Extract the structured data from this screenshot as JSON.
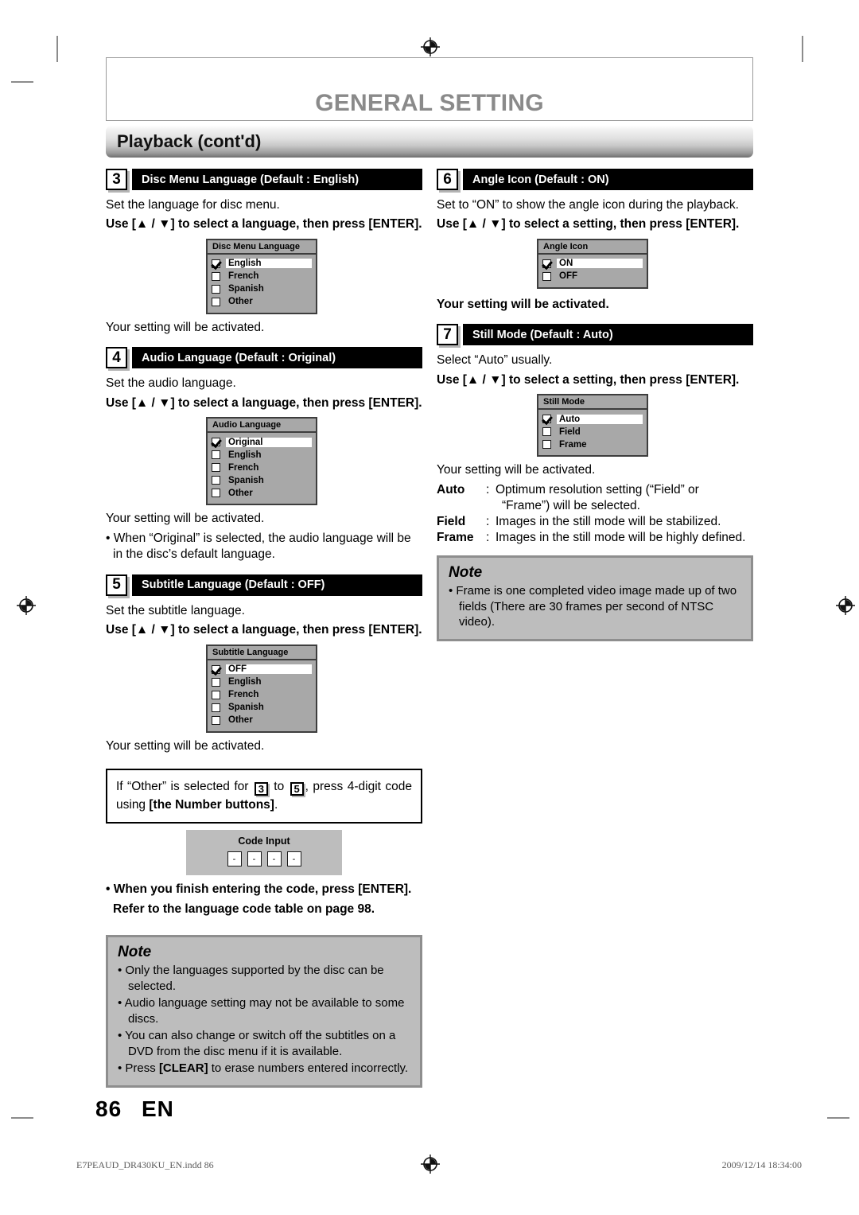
{
  "header": {
    "title": "GENERAL SETTING",
    "section_bar": "Playback (cont'd)"
  },
  "left_column": {
    "step3": {
      "number": "3",
      "title": "Disc Menu Language (Default : English)",
      "desc": "Set the language for disc menu.",
      "instruction": "Use [▲ / ▼] to select a language, then press [ENTER].",
      "osd": {
        "title": "Disc Menu Language",
        "options": [
          {
            "label": "English",
            "selected": true
          },
          {
            "label": "French",
            "selected": false
          },
          {
            "label": "Spanish",
            "selected": false
          },
          {
            "label": "Other",
            "selected": false
          }
        ]
      },
      "after": "Your setting will be activated."
    },
    "step4": {
      "number": "4",
      "title": "Audio Language (Default : Original)",
      "desc": "Set the audio language.",
      "instruction": "Use [▲ / ▼] to select a language, then press [ENTER].",
      "osd": {
        "title": "Audio Language",
        "options": [
          {
            "label": "Original",
            "selected": true
          },
          {
            "label": "English",
            "selected": false
          },
          {
            "label": "French",
            "selected": false
          },
          {
            "label": "Spanish",
            "selected": false
          },
          {
            "label": "Other",
            "selected": false
          }
        ]
      },
      "after": "Your setting will be activated.",
      "bullet": "• When “Original” is selected, the audio language will be in the disc’s default language."
    },
    "step5": {
      "number": "5",
      "title": "Subtitle Language (Default : OFF)",
      "desc": "Set the subtitle language.",
      "instruction": "Use [▲ / ▼] to select a language, then press [ENTER].",
      "osd": {
        "title": "Subtitle Language",
        "options": [
          {
            "label": "OFF",
            "selected": true
          },
          {
            "label": "English",
            "selected": false
          },
          {
            "label": "French",
            "selected": false
          },
          {
            "label": "Spanish",
            "selected": false
          },
          {
            "label": "Other",
            "selected": false
          }
        ]
      },
      "after": "Your setting will be activated."
    },
    "callout": {
      "part1": "If “Other” is selected for",
      "num_from": "3",
      "part2": "to",
      "num_to": "5",
      "part3": ", press 4-digit code using",
      "bold_part": "[the Number buttons]",
      "part4": "."
    },
    "code_osd": {
      "title": "Code Input",
      "cells": [
        "-",
        "-",
        "-",
        "-"
      ]
    },
    "code_note_line1": "• When you finish entering the code, press [ENTER].",
    "code_note_line2": "Refer to the language code table on page 98.",
    "note": {
      "title": "Note",
      "items": [
        "• Only the languages supported by the disc can be selected.",
        "• Audio language setting may not be available to some discs.",
        "• You can also change or switch off the subtitles on a DVD from the disc menu if it is available.",
        "• Press [CLEAR] to erase numbers entered incorrectly."
      ]
    }
  },
  "right_column": {
    "step6": {
      "number": "6",
      "title": "Angle Icon (Default : ON)",
      "desc": "Set to “ON” to show the angle icon during the playback.",
      "instruction": "Use [▲ / ▼] to select a setting, then press [ENTER].",
      "osd": {
        "title": "Angle Icon",
        "options": [
          {
            "label": "ON",
            "selected": true
          },
          {
            "label": "OFF",
            "selected": false
          }
        ]
      },
      "after": "Your setting will be activated."
    },
    "step7": {
      "number": "7",
      "title": "Still Mode (Default : Auto)",
      "desc": "Select “Auto” usually.",
      "instruction": "Use [▲ / ▼] to select a setting, then press [ENTER].",
      "osd": {
        "title": "Still Mode",
        "options": [
          {
            "label": "Auto",
            "selected": true
          },
          {
            "label": "Field",
            "selected": false
          },
          {
            "label": "Frame",
            "selected": false
          }
        ]
      },
      "after": "Your setting will be activated.",
      "definitions": [
        {
          "term": "Auto",
          "colon": ":",
          "desc": "Optimum resolution setting (“Field” or",
          "cont": "“Frame”) will be selected."
        },
        {
          "term": "Field",
          "colon": ":",
          "desc": "Images in the still mode will be stabilized.",
          "cont": ""
        },
        {
          "term": "Frame",
          "colon": ":",
          "desc": "Images in the still mode will be highly defined.",
          "cont": ""
        }
      ]
    },
    "note": {
      "title": "Note",
      "items": [
        "• Frame is one completed video image made up of two fields (There are 30 frames per second of NTSC video)."
      ]
    }
  },
  "footer": {
    "page_number": "86",
    "page_lang": "EN",
    "file_name": "E7PEAUD_DR430KU_EN.indd   86",
    "timestamp": "2009/12/14   18:34:00"
  }
}
